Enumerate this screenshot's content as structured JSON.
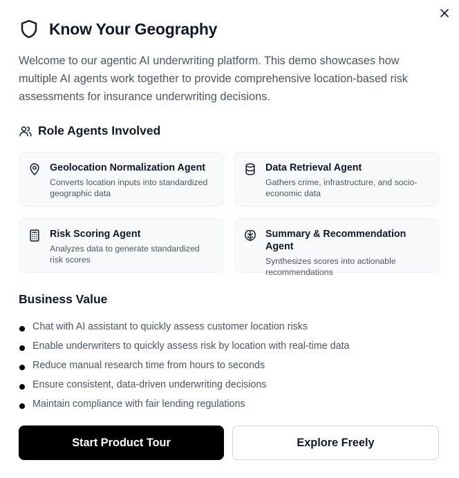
{
  "dialog": {
    "close_icon": "close-icon",
    "title": "Know Your Geography",
    "title_icon": "shield-icon",
    "intro": "Welcome to our agentic AI underwriting platform. This demo showcases how multiple AI agents work together to provide comprehensive location-based risk assessments for insurance underwriting decisions."
  },
  "agents": {
    "heading": "Role Agents Involved",
    "heading_icon": "users-icon",
    "items": [
      {
        "name": "Geolocation Normalization Agent",
        "description": "Converts location inputs into standardized geographic data",
        "icon": "map-pin-icon"
      },
      {
        "name": "Data Retrieval Agent",
        "description": "Gathers crime, infrastructure, and socio-economic data",
        "icon": "database-icon"
      },
      {
        "name": "Risk Scoring Agent",
        "description": "Analyzes data to generate standardized risk scores",
        "icon": "calculator-icon"
      },
      {
        "name": "Summary & Recommendation Agent",
        "description": "Synthesizes scores into actionable recommendations",
        "icon": "brain-icon"
      }
    ]
  },
  "business_value": {
    "heading": "Business Value",
    "items": [
      "Chat with AI assistant to quickly assess customer location risks",
      "Enable underwriters to quickly assess risk by location with real-time data",
      "Reduce manual research time from hours to seconds",
      "Ensure consistent, data-driven underwriting decisions",
      "Maintain compliance with fair lending regulations"
    ]
  },
  "actions": {
    "primary_label": "Start Product Tour",
    "secondary_label": "Explore Freely"
  },
  "colors": {
    "primary_button": "#000000",
    "card_background": "#f8f9fb",
    "body_text": "#4b5563",
    "heading_text": "#111827"
  }
}
